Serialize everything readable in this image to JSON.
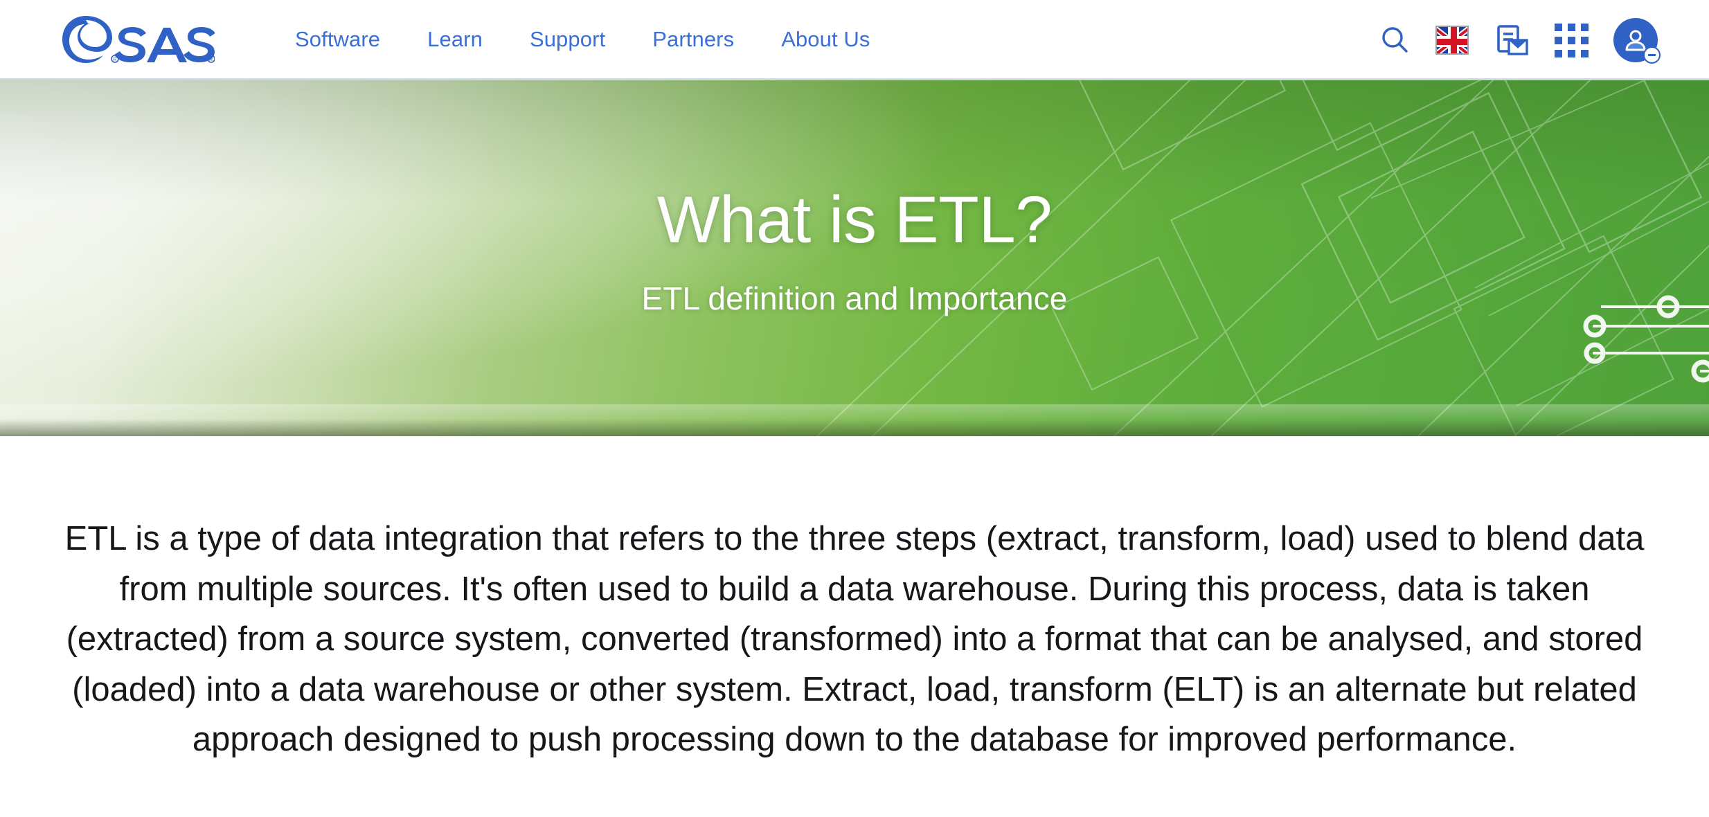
{
  "header": {
    "logo": {
      "name": "sas-logo",
      "text": "sas",
      "trademark": "®"
    },
    "nav_items": [
      {
        "label": "Software",
        "name": "nav-software"
      },
      {
        "label": "Learn",
        "name": "nav-learn"
      },
      {
        "label": "Support",
        "name": "nav-support"
      },
      {
        "label": "Partners",
        "name": "nav-partners"
      },
      {
        "label": "About Us",
        "name": "nav-about-us"
      }
    ],
    "tools": [
      {
        "icon": "search-icon",
        "label": "Search"
      },
      {
        "icon": "uk-flag-icon",
        "label": "United Kingdom"
      },
      {
        "icon": "subscribe-document-icon",
        "label": "Subscribe"
      },
      {
        "icon": "apps-grid-icon",
        "label": "Apps"
      },
      {
        "icon": "user-avatar-icon",
        "label": "Sign In"
      }
    ],
    "colors": {
      "link": "#3a6fd8",
      "icon": "#2f62c4",
      "border": "#c9dbe4"
    }
  },
  "hero": {
    "title": "What is ETL?",
    "subtitle": "ETL definition and Importance",
    "colors": {
      "gradient_light": "#eef3e4",
      "gradient_mid": "#8ec25f",
      "gradient_dark": "#4fa23a",
      "text": "#ffffff"
    }
  },
  "main": {
    "intro_paragraph": "ETL is a type of data integration that refers to the three steps (extract, transform, load) used to blend data from multiple sources. It's often used to build a data warehouse. During this process, data is taken (extracted) from a source system, converted (transformed) into a format that can be analysed, and stored (loaded) into a data warehouse or other system. Extract, load, transform (ELT) is an alternate but related approach designed to push processing down to the database for improved performance."
  }
}
